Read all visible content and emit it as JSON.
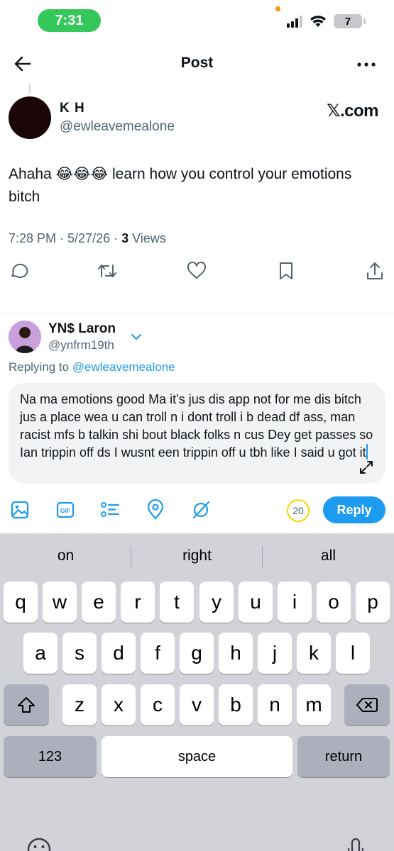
{
  "status_bar": {
    "time": "7:31",
    "battery": "7"
  },
  "header": {
    "title": "Post"
  },
  "post": {
    "name": "K H",
    "handle": "@ewleavemealone",
    "watermark": "𝕏.com",
    "text": "Ahaha 😂😂😂 learn how you control your emotions bitch",
    "time": "7:28 PM · 5/27/26 · ",
    "views_count": "3",
    "views_label": " Views"
  },
  "reply": {
    "name": "YN$ Laron",
    "handle": "@ynfrm19th",
    "replying_to_prefix": "Replying to ",
    "replying_to_handle": "@ewleavemealone",
    "draft": "Na ma emotions good Ma it’s jus dis app not for me dis bitch jus a place wea u can troll n i dont troll i b dead df ass, man racist mfs b talkin shi bout black folks n cus Dey get passes so Ian trippin off ds I wusnt een trippin off u tbh like I said u got it",
    "char_remaining": "20",
    "reply_button": "Reply"
  },
  "keyboard": {
    "suggestions": [
      "on",
      "right",
      "all"
    ],
    "row1": [
      "q",
      "w",
      "e",
      "r",
      "t",
      "y",
      "u",
      "i",
      "o",
      "p"
    ],
    "row2": [
      "a",
      "s",
      "d",
      "f",
      "g",
      "h",
      "j",
      "k",
      "l"
    ],
    "row3": [
      "z",
      "x",
      "c",
      "v",
      "b",
      "n",
      "m"
    ],
    "numbers_key": "123",
    "space_key": "space",
    "return_key": "return"
  },
  "colors": {
    "accent": "#1d9bf0",
    "time_pill": "#34c759",
    "counter_ring": "#ffd400"
  }
}
